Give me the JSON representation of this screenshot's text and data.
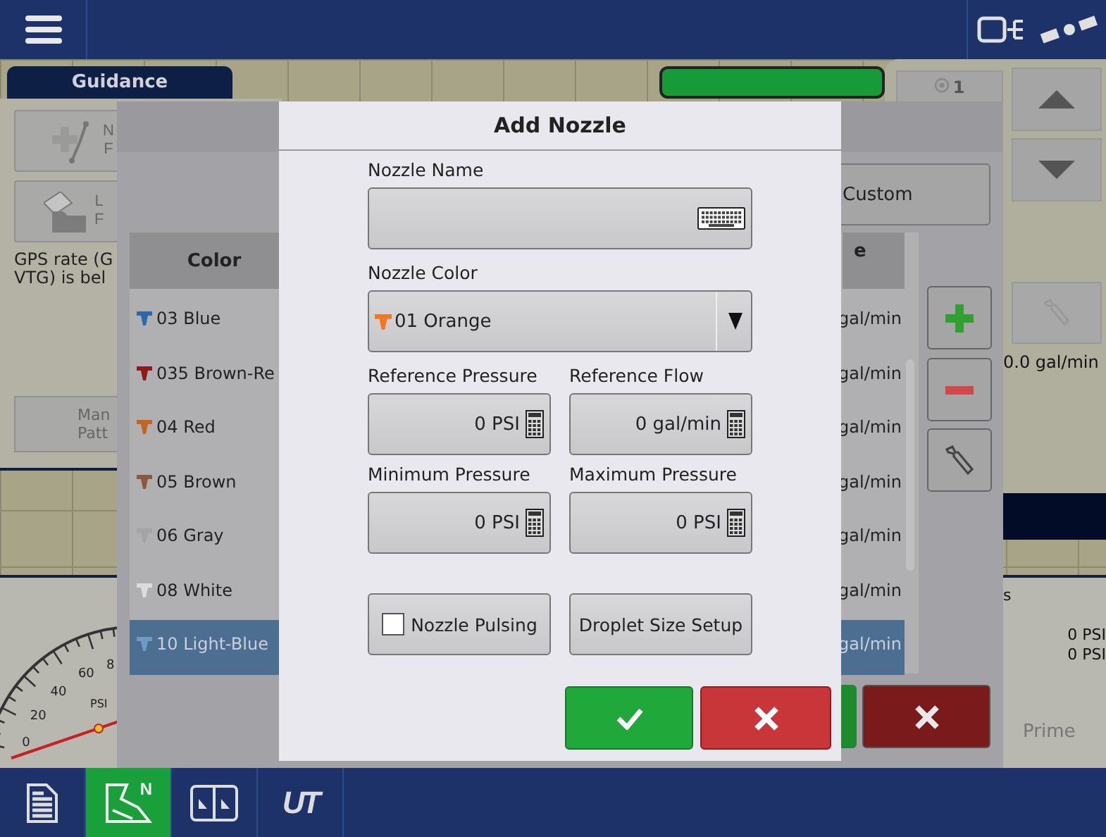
{
  "background": {
    "tab": "Guidance",
    "left_buttons": [
      {
        "kind": "line",
        "lines": [
          "N",
          "F"
        ]
      },
      {
        "kind": "folder",
        "lines": [
          "L",
          "F"
        ]
      }
    ],
    "gps_note": [
      "GPS rate (G",
      "VTG) is bel"
    ],
    "pattern_button": [
      "Man",
      "Patt"
    ],
    "gauge": {
      "tick_labels": [
        "60",
        "8",
        "40",
        "20",
        "0"
      ],
      "unit": "PSI"
    },
    "section_button": "1",
    "flow_reading": "0.0 gal/min",
    "label_fragment": "s",
    "pressure_readings": [
      "0 PSI",
      "0 PSI"
    ],
    "prime_button": "Prime"
  },
  "nozzle_list": {
    "custom_button": "Custom",
    "columns": [
      "Color",
      "e"
    ],
    "rows": [
      {
        "name": "03 Blue",
        "color": "#2a6aa8",
        "flow": "gal/min",
        "selected": false
      },
      {
        "name": "035 Brown-Re",
        "color": "#8a1c1c",
        "flow": "gal/min",
        "selected": false
      },
      {
        "name": "04 Red",
        "color": "#c8641c",
        "flow": "gal/min",
        "selected": false
      },
      {
        "name": "05 Brown",
        "color": "#8a5a44",
        "flow": "gal/min",
        "selected": false
      },
      {
        "name": "06 Gray",
        "color": "#a4a4a4",
        "flow": "gal/min",
        "selected": false
      },
      {
        "name": "08 White",
        "color": "#dcdcdc",
        "flow": "gal/min",
        "selected": false
      },
      {
        "name": "10 Light-Blue",
        "color": "#6c9cc4",
        "flow": "gal/min",
        "selected": true
      }
    ]
  },
  "add_nozzle": {
    "title": "Add Nozzle",
    "name_label": "Nozzle Name",
    "color_label": "Nozzle Color",
    "color_value": {
      "name": "01 Orange",
      "color": "#f07820"
    },
    "fields": [
      {
        "label": "Reference Pressure",
        "value": "0 PSI"
      },
      {
        "label": "Reference Flow",
        "value": "0 gal/min"
      },
      {
        "label": "Minimum Pressure",
        "value": "0 PSI"
      },
      {
        "label": "Maximum Pressure",
        "value": "0 PSI"
      }
    ],
    "pulsing": {
      "label": "Nozzle Pulsing",
      "checked": false
    },
    "droplet_button": "Droplet Size Setup"
  },
  "bottom_bar": {
    "tabs": [
      {
        "kind": "document",
        "selected": false
      },
      {
        "kind": "map",
        "label": "N",
        "selected": true
      },
      {
        "kind": "split",
        "selected": false
      },
      {
        "kind": "ut",
        "label": "UT",
        "selected": false
      }
    ]
  }
}
